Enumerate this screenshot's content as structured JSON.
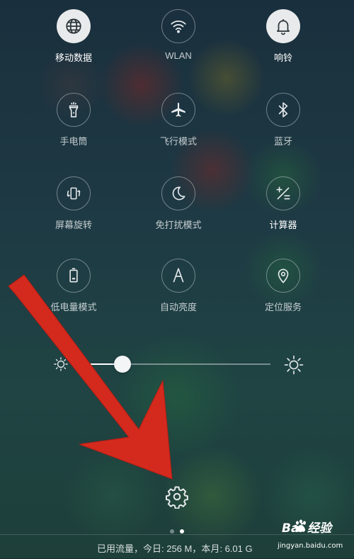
{
  "tiles": [
    {
      "label": "移动数据",
      "icon": "globe-icon",
      "active": true
    },
    {
      "label": "WLAN",
      "icon": "wifi-icon",
      "active": false
    },
    {
      "label": "响铃",
      "icon": "bell-icon",
      "active": true
    },
    {
      "label": "手电筒",
      "icon": "flashlight-icon",
      "active": false
    },
    {
      "label": "飞行模式",
      "icon": "airplane-icon",
      "active": false
    },
    {
      "label": "蓝牙",
      "icon": "bluetooth-icon",
      "active": false
    },
    {
      "label": "屏幕旋转",
      "icon": "screen-rotate-icon",
      "active": false
    },
    {
      "label": "免打扰模式",
      "icon": "moon-icon",
      "active": false
    },
    {
      "label": "计算器",
      "icon": "calculator-icon",
      "active": false
    },
    {
      "label": "低电量模式",
      "icon": "battery-icon",
      "active": false
    },
    {
      "label": "自动亮度",
      "icon": "letter-a-icon",
      "active": false
    },
    {
      "label": "定位服务",
      "icon": "location-pin-icon",
      "active": false
    }
  ],
  "brightness": {
    "level": 0.23,
    "min_icon": "sun-small-icon",
    "max_icon": "sun-large-icon"
  },
  "settings": {
    "icon": "gear-icon"
  },
  "pager": {
    "pages": 2,
    "current": 2
  },
  "footer": {
    "data_usage": "已用流量，今日: 256 M，本月: 6.01 G"
  },
  "watermark": {
    "brand": "Bai 经验",
    "url": "jingyan.baidu.com",
    "logo": "baidu-paw-icon"
  },
  "overlay": {
    "annotation": "red-arrow-pointing-to-gear",
    "color": "#d42a1e"
  },
  "colors": {
    "active_fill": "#e8eaec",
    "icon_light": "#e6eaec",
    "icon_dark": "#2a3438"
  }
}
